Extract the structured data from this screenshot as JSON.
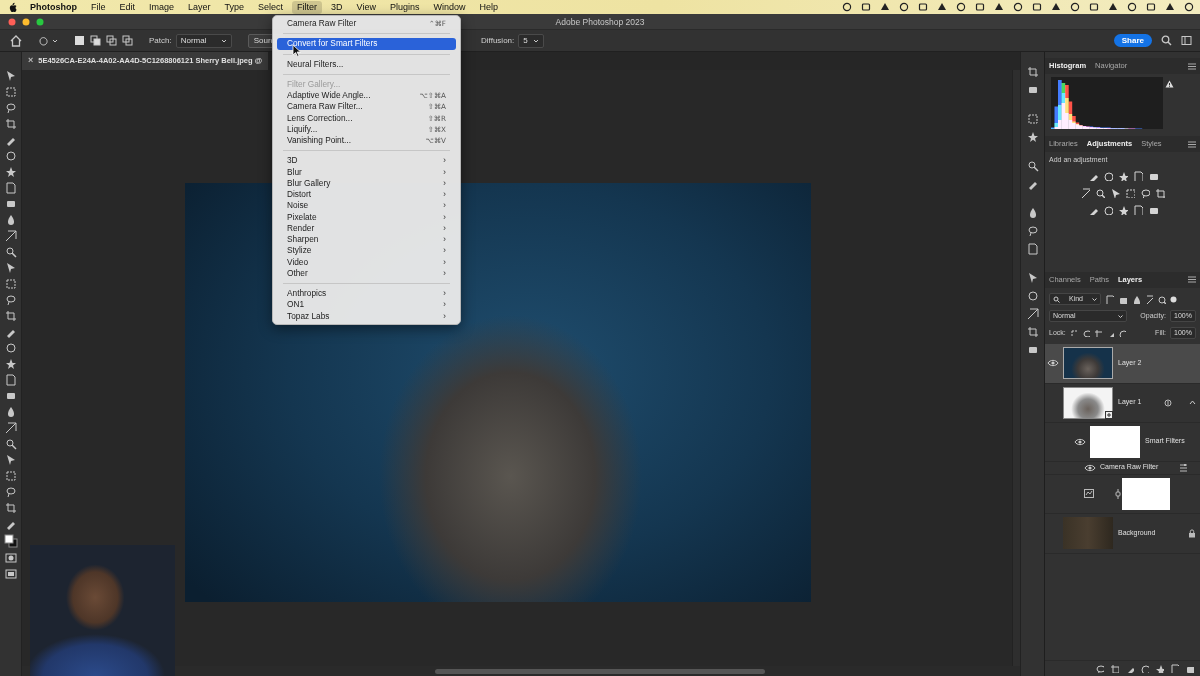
{
  "menubar": {
    "app": "Photoshop",
    "items": [
      {
        "label": "File",
        "selected": false
      },
      {
        "label": "Edit",
        "selected": false
      },
      {
        "label": "Image",
        "selected": false
      },
      {
        "label": "Layer",
        "selected": false
      },
      {
        "label": "Type",
        "selected": false
      },
      {
        "label": "Select",
        "selected": false
      },
      {
        "label": "Filter",
        "selected": true
      },
      {
        "label": "3D",
        "selected": false
      },
      {
        "label": "View",
        "selected": false
      },
      {
        "label": "Plugins",
        "selected": false
      },
      {
        "label": "Window",
        "selected": false
      },
      {
        "label": "Help",
        "selected": false
      }
    ]
  },
  "window": {
    "title": "Adobe Photoshop 2023"
  },
  "options_bar": {
    "mode_label": "Patch:",
    "mode_value": "Normal",
    "source_button": "Source",
    "diffusion_label": "Diffusion:",
    "diffusion_value": "5",
    "share_button": "Share"
  },
  "document_tab": {
    "close": "×",
    "title": "5E4526CA-E24A-4A02-AA4D-5C1268806121 Sherry Bell.jpeg @"
  },
  "filter_menu": {
    "items": [
      {
        "kind": "item",
        "label": "Camera Raw Filter",
        "shortcut": "⌃⌘F",
        "selected": false,
        "disabled": false
      },
      {
        "kind": "separator"
      },
      {
        "kind": "item",
        "label": "Convert for Smart Filters",
        "selected": true,
        "disabled": false
      },
      {
        "kind": "separator"
      },
      {
        "kind": "item",
        "label": "Neural Filters...",
        "selected": false,
        "disabled": false
      },
      {
        "kind": "separator"
      },
      {
        "kind": "item",
        "label": "Filter Gallery...",
        "selected": false,
        "disabled": true
      },
      {
        "kind": "item",
        "label": "Adaptive Wide Angle...",
        "shortcut": "⌥⇧⌘A",
        "selected": false,
        "disabled": false
      },
      {
        "kind": "item",
        "label": "Camera Raw Filter...",
        "shortcut": "⇧⌘A",
        "selected": false,
        "disabled": false
      },
      {
        "kind": "item",
        "label": "Lens Correction...",
        "shortcut": "⇧⌘R",
        "selected": false,
        "disabled": false
      },
      {
        "kind": "item",
        "label": "Liquify...",
        "shortcut": "⇧⌘X",
        "selected": false,
        "disabled": false
      },
      {
        "kind": "item",
        "label": "Vanishing Point...",
        "shortcut": "⌥⌘V",
        "selected": false,
        "disabled": false
      },
      {
        "kind": "separator"
      },
      {
        "kind": "submenu",
        "label": "3D",
        "arrow": "›",
        "selected": false,
        "disabled": false
      },
      {
        "kind": "submenu",
        "label": "Blur",
        "arrow": "›",
        "selected": false,
        "disabled": false
      },
      {
        "kind": "submenu",
        "label": "Blur Gallery",
        "arrow": "›",
        "selected": false,
        "disabled": false
      },
      {
        "kind": "submenu",
        "label": "Distort",
        "arrow": "›",
        "selected": false,
        "disabled": false
      },
      {
        "kind": "submenu",
        "label": "Noise",
        "arrow": "›",
        "selected": false,
        "disabled": false
      },
      {
        "kind": "submenu",
        "label": "Pixelate",
        "arrow": "›",
        "selected": false,
        "disabled": false
      },
      {
        "kind": "submenu",
        "label": "Render",
        "arrow": "›",
        "selected": false,
        "disabled": false
      },
      {
        "kind": "submenu",
        "label": "Sharpen",
        "arrow": "›",
        "selected": false,
        "disabled": false
      },
      {
        "kind": "submenu",
        "label": "Stylize",
        "arrow": "›",
        "selected": false,
        "disabled": false
      },
      {
        "kind": "submenu",
        "label": "Video",
        "arrow": "›",
        "selected": false,
        "disabled": false
      },
      {
        "kind": "submenu",
        "label": "Other",
        "arrow": "›",
        "selected": false,
        "disabled": false
      },
      {
        "kind": "separator"
      },
      {
        "kind": "submenu",
        "label": "Anthropics",
        "arrow": "›",
        "selected": false,
        "disabled": false
      },
      {
        "kind": "submenu",
        "label": "ON1",
        "arrow": "›",
        "selected": false,
        "disabled": false
      },
      {
        "kind": "submenu",
        "label": "Topaz Labs",
        "arrow": "›",
        "selected": false,
        "disabled": false
      }
    ]
  },
  "histogram_panel": {
    "tabs": [
      {
        "label": "Histogram",
        "selected": true
      },
      {
        "label": "Navigator",
        "selected": false
      }
    ],
    "series": [
      {
        "color": "#ff3b30",
        "values": [
          0,
          4,
          18,
          52,
          88,
          55,
          26,
          13,
          8,
          6,
          5,
          4,
          3,
          3,
          2,
          2,
          2,
          1,
          1,
          1,
          1,
          1,
          1,
          1,
          0,
          0,
          0,
          0,
          0,
          0,
          0,
          0
        ]
      },
      {
        "color": "#33d24a",
        "values": [
          1,
          12,
          48,
          92,
          62,
          30,
          15,
          10,
          7,
          5,
          4,
          3,
          3,
          2,
          2,
          2,
          1,
          1,
          1,
          1,
          1,
          1,
          0,
          0,
          0,
          0,
          0,
          0,
          0,
          0,
          0,
          0
        ]
      },
      {
        "color": "#2a6bff",
        "values": [
          3,
          45,
          98,
          72,
          32,
          18,
          12,
          9,
          7,
          6,
          5,
          5,
          4,
          4,
          3,
          3,
          3,
          2,
          2,
          2,
          2,
          1,
          1,
          1,
          1,
          1,
          0,
          0,
          0,
          0,
          0,
          0
        ]
      }
    ]
  },
  "adjustments_panel": {
    "tabs": [
      {
        "label": "Libraries",
        "selected": false
      },
      {
        "label": "Adjustments",
        "selected": true
      },
      {
        "label": "Styles",
        "selected": false
      }
    ],
    "hint": "Add an adjustment"
  },
  "layers_panel": {
    "tabs": [
      {
        "label": "Channels",
        "selected": false
      },
      {
        "label": "Paths",
        "selected": false
      },
      {
        "label": "Layers",
        "selected": true
      }
    ],
    "filter_kind": "Kind",
    "blend_mode": "Normal",
    "opacity_label": "Opacity:",
    "opacity_value": "100%",
    "lock_label": "Lock:",
    "fill_label": "Fill:",
    "fill_value": "100%",
    "layers": [
      {
        "kind": "layer",
        "name": "Layer 2",
        "visible": true,
        "selected": true,
        "locked": false
      },
      {
        "kind": "smart-object",
        "name": "Layer 1",
        "visible": false,
        "selected": false,
        "locked": false,
        "expanded": true
      },
      {
        "kind": "smart-filters",
        "name": "Smart Filters",
        "visible": true,
        "selected": false
      },
      {
        "kind": "filter",
        "name": "Camera Raw Filter",
        "visible": true,
        "selected": false
      },
      {
        "kind": "mask",
        "selected": false
      },
      {
        "kind": "background",
        "name": "Background",
        "visible": false,
        "selected": false,
        "locked": true
      }
    ]
  }
}
